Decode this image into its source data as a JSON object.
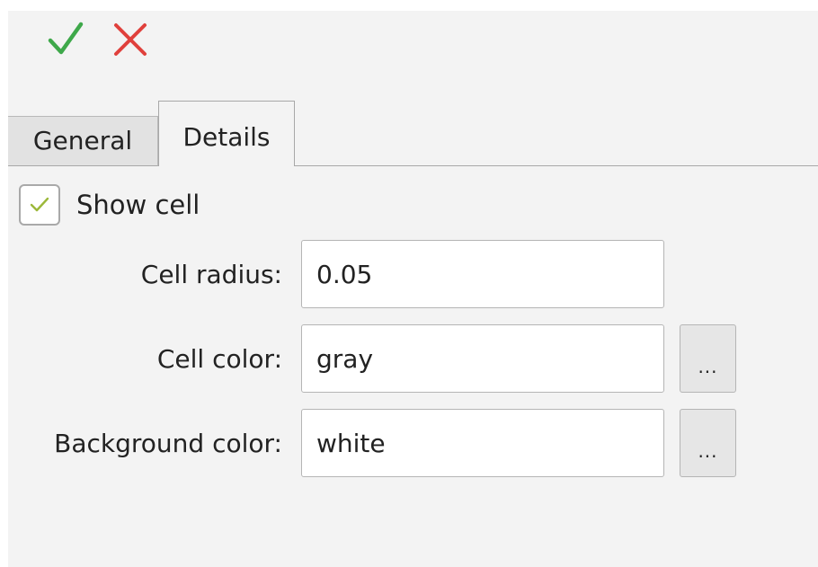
{
  "toolbar": {
    "apply_icon": "checkmark-icon",
    "apply_color": "#3ea84a",
    "cancel_icon": "close-icon",
    "cancel_color": "#e0403c"
  },
  "tabs": [
    {
      "label": "General",
      "active": false
    },
    {
      "label": "Details",
      "active": true
    }
  ],
  "details": {
    "show_cell": {
      "label": "Show cell",
      "checked": true,
      "check_color": "#9cb83a"
    },
    "cell_radius": {
      "label": "Cell radius:",
      "value": "0.05"
    },
    "cell_color": {
      "label": "Cell color:",
      "value": "gray",
      "button_label": "..."
    },
    "background_color": {
      "label": "Background color:",
      "value": "white",
      "button_label": "..."
    }
  }
}
